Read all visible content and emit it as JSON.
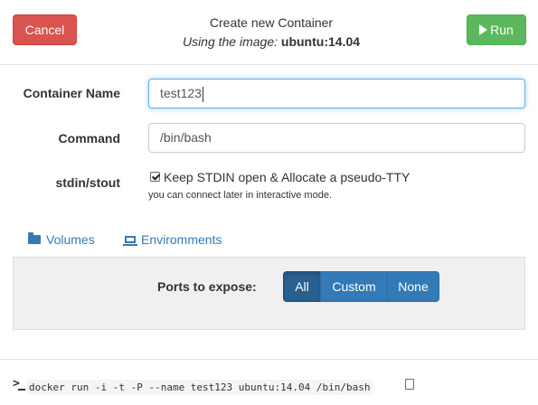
{
  "header": {
    "cancel_label": "Cancel",
    "run_label": "Run",
    "title": "Create new Container",
    "subtitle_lead": "Using the image:",
    "image_name": "ubuntu:14.04"
  },
  "form": {
    "container_name_label": "Container Name",
    "container_name_value": "test123",
    "command_label": "Command",
    "command_value": "/bin/bash",
    "stdin_label": "stdin/stout",
    "stdin_checked": true,
    "stdin_option_label": "Keep STDIN open & Allocate a pseudo-TTY",
    "stdin_help": "you can connect later in interactive mode."
  },
  "tabs": {
    "volumes_label": "Volumes",
    "environments_label": "Enviromments"
  },
  "ports": {
    "label": "Ports to expose:",
    "options": [
      "All",
      "Custom",
      "None"
    ],
    "selected": "All"
  },
  "footer": {
    "command_preview": "docker run -i -t -P --name test123 ubuntu:14.04 /bin/bash"
  },
  "colors": {
    "cancel": "#d9534f",
    "run": "#5cb85c",
    "primary": "#337ab7",
    "primary_active": "#286090",
    "panel_bg": "#f0f0f0"
  }
}
